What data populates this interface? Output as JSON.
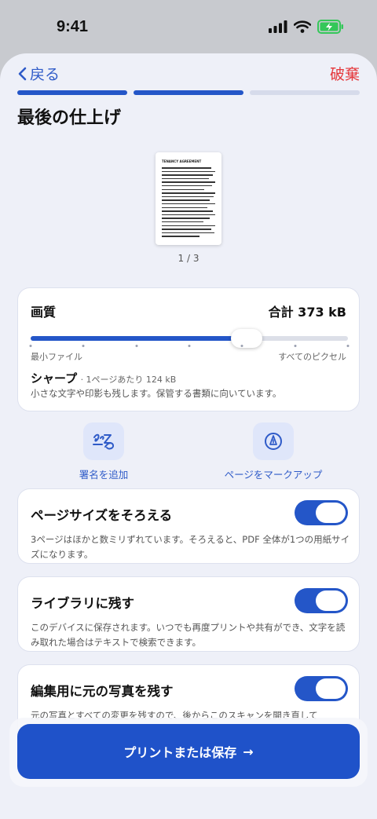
{
  "status_bar": {
    "time": "9:41"
  },
  "nav": {
    "back_label": "戻る",
    "discard_label": "破棄"
  },
  "progress": {
    "steps_total": 3,
    "steps_done": 2
  },
  "page_title": "最後の仕上げ",
  "preview": {
    "doc_heading": "TENANCY AGREEMENT",
    "page_indicator": "1 / 3"
  },
  "quality": {
    "title": "画質",
    "total": "合計 373 kB",
    "slider_value": 0.68,
    "tick_count": 7,
    "min_label": "最小ファイル",
    "max_label": "すべてのピクセル",
    "mode_name": "シャープ",
    "mode_sub": "· 1ページあたり 124 kB",
    "mode_desc": "小さな文字や印影も残します。保管する書類に向いています。"
  },
  "tools": {
    "signature": {
      "label": "署名を追加",
      "icon": "signature-icon"
    },
    "markup": {
      "label": "ページをマークアップ",
      "icon": "pen-markup-icon"
    }
  },
  "toggles": [
    {
      "title": "ページサイズをそろえる",
      "desc": "3ページはほかと数ミリずれています。そろえると、PDF 全体が1つの用紙サイズになります。",
      "on": true
    },
    {
      "title": "ライブラリに残す",
      "desc": "このデバイスに保存されます。いつでも再度プリントや共有ができ、文字を読み取れた場合はテキストで検索できます。",
      "on": true
    },
    {
      "title": "編集用に元の写真を残す",
      "desc": "元の写真とすべての変更を残すので、後からこのスキャンを開き直して",
      "on": true
    }
  ],
  "primary_action": {
    "label": "プリントまたは保存",
    "arrow": "→"
  },
  "colors": {
    "accent": "#2456c8",
    "danger": "#e5363a",
    "battery": "#34c759"
  }
}
